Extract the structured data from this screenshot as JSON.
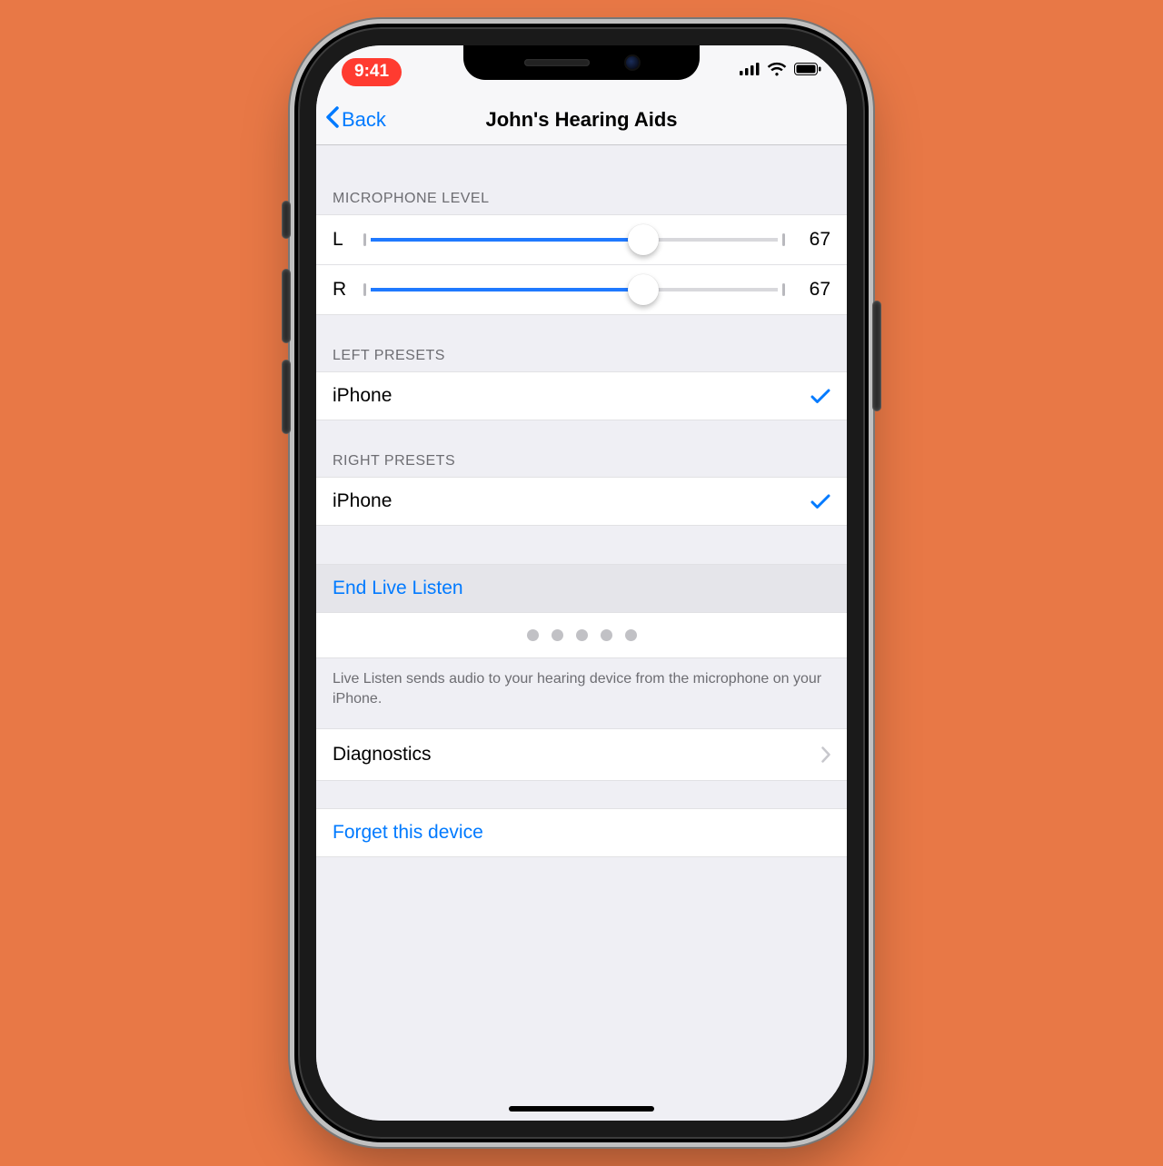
{
  "statusbar": {
    "time": "9:41"
  },
  "nav": {
    "back": "Back",
    "title": "John's Hearing Aids"
  },
  "mic": {
    "header": "MICROPHONE LEVEL",
    "left": {
      "label": "L",
      "value": 67,
      "percent": 67
    },
    "right": {
      "label": "R",
      "value": 67,
      "percent": 67
    }
  },
  "leftPresets": {
    "header": "LEFT PRESETS",
    "item": "iPhone"
  },
  "rightPresets": {
    "header": "RIGHT PRESETS",
    "item": "iPhone"
  },
  "liveListen": {
    "toggleLabel": "End Live Listen",
    "description": "Live Listen sends audio to your hearing device from the microphone on your iPhone."
  },
  "diagnostics": {
    "label": "Diagnostics"
  },
  "forget": {
    "label": "Forget this device"
  }
}
